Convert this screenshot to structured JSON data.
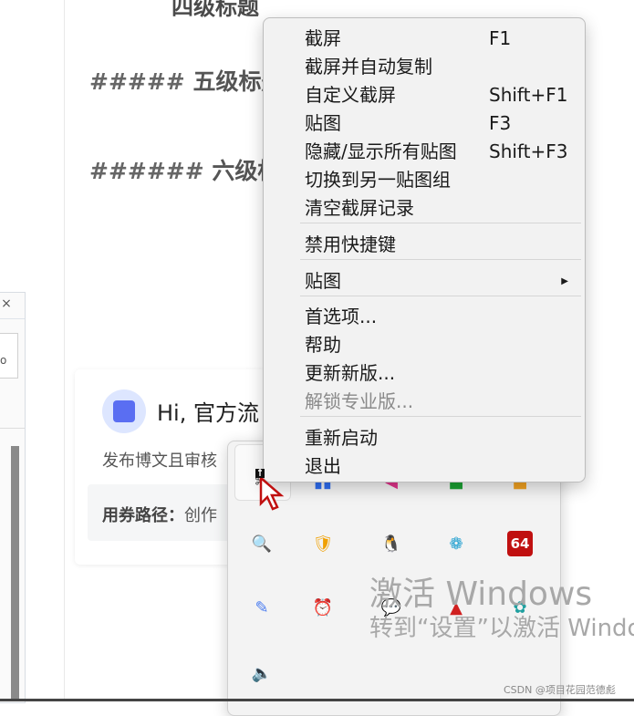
{
  "document": {
    "top_heading": "四级标题",
    "h5": {
      "hashes": "#####",
      "text": "五级标题"
    },
    "h6": {
      "hashes": "######",
      "text": "六级标"
    }
  },
  "side_panel": {
    "close": "×",
    "field_text": "o"
  },
  "card": {
    "greeting": "Hi, 官方流",
    "desc": "发布博文且审核",
    "route_label": "用券路径：",
    "route_value": "创作"
  },
  "context_menu": {
    "items": [
      {
        "label": "截屏",
        "shortcut": "F1"
      },
      {
        "label": "截屏并自动复制",
        "shortcut": ""
      },
      {
        "label": "自定义截屏",
        "shortcut": "Shift+F1"
      },
      {
        "label": "贴图",
        "shortcut": "F3"
      },
      {
        "label": "隐藏/显示所有贴图",
        "shortcut": "Shift+F3"
      },
      {
        "label": "切换到另一贴图组",
        "shortcut": ""
      },
      {
        "label": "清空截屏记录",
        "shortcut": ""
      },
      {
        "label": "禁用快捷键",
        "shortcut": ""
      },
      {
        "label": "贴图",
        "shortcut": "",
        "submenu_arrow": "▶"
      },
      {
        "label": "首选项...",
        "shortcut": ""
      },
      {
        "label": "帮助",
        "shortcut": ""
      },
      {
        "label": "更新新版...",
        "shortcut": ""
      },
      {
        "label": "解锁专业版...",
        "shortcut": "",
        "disabled": true
      },
      {
        "label": "重新启动",
        "shortcut": ""
      },
      {
        "label": "退出",
        "shortcut": ""
      }
    ]
  },
  "tray": {
    "icons": [
      {
        "name": "snipaste-icon",
        "glyph": "✂",
        "color": "#222"
      },
      {
        "name": "blue-app-icon",
        "glyph": "▮▮",
        "color": "#2d6cf0"
      },
      {
        "name": "pink-app-icon",
        "glyph": "◀",
        "color": "#e0338a"
      },
      {
        "name": "green-app-icon",
        "glyph": "■",
        "color": "#1aa032"
      },
      {
        "name": "orange-app-icon",
        "glyph": "■",
        "color": "#f0a020"
      },
      {
        "name": "search-orange-icon",
        "glyph": "🔍",
        "color": "#e07020"
      },
      {
        "name": "security-icon",
        "glyph": "🛡",
        "color": "#f0a000"
      },
      {
        "name": "qq-icon",
        "glyph": "🐧",
        "color": "#111"
      },
      {
        "name": "colorful-swirl-icon",
        "glyph": "❁",
        "color": "#22a0d0"
      },
      {
        "name": "aida64-icon",
        "glyph": "64",
        "color": "#c01010"
      },
      {
        "name": "pen-app-icon",
        "glyph": "✎",
        "color": "#4a7cf0"
      },
      {
        "name": "alarm-clock-icon",
        "glyph": "⏰",
        "color": "#d02020"
      },
      {
        "name": "wechat-icon",
        "glyph": "💬",
        "color": "#2aae3a"
      },
      {
        "name": "triangle-app-icon",
        "glyph": "▲",
        "color": "#d02020"
      },
      {
        "name": "cluster-app-icon",
        "glyph": "✿",
        "color": "#20a0a0"
      },
      {
        "name": "speaker-icon",
        "glyph": "🔈",
        "color": "#222"
      }
    ]
  },
  "watermark": {
    "line1": "激活 Windows",
    "line2": "转到“设置”以激活 Windo"
  },
  "credit": "CSDN @项目花园范德彪"
}
